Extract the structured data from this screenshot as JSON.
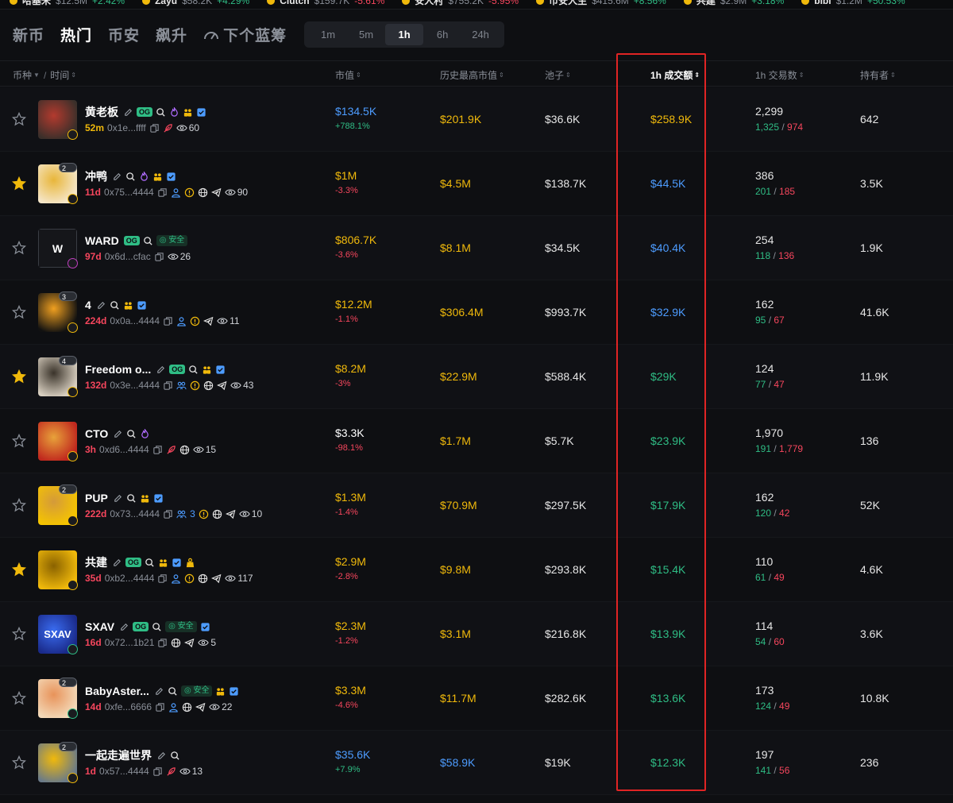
{
  "ticker": [
    {
      "name": "哈基米",
      "value": "$12.5M",
      "change": "+2.42%",
      "dir": "up"
    },
    {
      "name": "Zayu",
      "value": "$58.2K",
      "change": "+4.29%",
      "dir": "up"
    },
    {
      "name": "Clutch",
      "value": "$159.7K",
      "change": "-5.61%",
      "dir": "dn"
    },
    {
      "name": "安人村",
      "value": "$755.2K",
      "change": "-5.95%",
      "dir": "dn"
    },
    {
      "name": "币安人生",
      "value": "$415.6M",
      "change": "+8.56%",
      "dir": "up"
    },
    {
      "name": "共建",
      "value": "$2.9M",
      "change": "+3.18%",
      "dir": "up"
    },
    {
      "name": "bibi",
      "value": "$1.2M",
      "change": "+50.53%",
      "dir": "up"
    }
  ],
  "nav": {
    "tabs": [
      "新币",
      "热门",
      "币安",
      "飙升",
      "下个蓝筹"
    ],
    "active_tab": "热门",
    "timeframes": [
      "1m",
      "5m",
      "1h",
      "6h",
      "24h"
    ],
    "active_timeframe": "1h"
  },
  "columns": {
    "token": "币种",
    "time": "时间",
    "mcap": "市值",
    "ath": "历史最高市值",
    "pool": "池子",
    "volume": "1h 成交额",
    "txns": "1h 交易数",
    "holders": "持有者"
  },
  "sort_glyph": "⇕",
  "rows": [
    {
      "starred": false,
      "name": "黄老板",
      "badge": "",
      "chain": "bnb",
      "avatar_colors": [
        "#3a2f2a",
        "#b33a2e"
      ],
      "avatar_glyph": "",
      "icons": [
        "edit-icon",
        "og",
        "search-icon",
        "fire-icon",
        "group-icon",
        "verified-icon"
      ],
      "age": "52m",
      "fresh": true,
      "addr": "0x1e...ffff",
      "sub_icons": [
        "copy-icon",
        "feather-icon"
      ],
      "views": "60",
      "mcap": "$134.5K",
      "mcap_color": "blue",
      "mcap_chg": "+788.1%",
      "mcap_dir": "up",
      "ath": "$201.9K",
      "pool": "$36.6K",
      "vol": "$258.9K",
      "vol_color": "yellow",
      "txns": "2,299",
      "buys": "1,325",
      "sells": "974",
      "holders": "642"
    },
    {
      "starred": true,
      "name": "冲鸭",
      "badge": "2",
      "chain": "bnb",
      "avatar_colors": [
        "#f5e6c8",
        "#e8b63a"
      ],
      "avatar_glyph": "",
      "icons": [
        "edit-icon",
        "search-icon",
        "fire-icon",
        "group-icon",
        "verified-icon"
      ],
      "age": "11d",
      "fresh": false,
      "addr": "0x75...4444",
      "sub_icons": [
        "copy-icon",
        "user-icon",
        "warning-icon",
        "globe-icon",
        "telegram-icon"
      ],
      "views": "90",
      "mcap": "$1M",
      "mcap_color": "yellow",
      "mcap_chg": "-3.3%",
      "mcap_dir": "dn",
      "ath": "$4.5M",
      "pool": "$138.7K",
      "vol": "$44.5K",
      "vol_color": "blue",
      "txns": "386",
      "buys": "201",
      "sells": "185",
      "holders": "3.5K"
    },
    {
      "starred": false,
      "name": "WARD",
      "badge": "",
      "chain": "other",
      "avatar_colors": [
        "#15161a",
        "#15161a"
      ],
      "avatar_glyph": "W",
      "icons": [
        "og",
        "search-icon",
        "safe"
      ],
      "safe_label": "安全",
      "age": "97d",
      "fresh": false,
      "addr": "0x6d...cfac",
      "sub_icons": [
        "copy-icon"
      ],
      "views": "26",
      "mcap": "$806.7K",
      "mcap_color": "yellow",
      "mcap_chg": "-3.6%",
      "mcap_dir": "dn",
      "ath": "$8.1M",
      "pool": "$34.5K",
      "vol": "$40.4K",
      "vol_color": "blue",
      "txns": "254",
      "buys": "118",
      "sells": "136",
      "holders": "1.9K"
    },
    {
      "starred": false,
      "name": "4",
      "badge": "3",
      "chain": "bnb",
      "avatar_colors": [
        "#111111",
        "#f0a020"
      ],
      "avatar_glyph": "",
      "icons": [
        "edit-icon",
        "search-icon",
        "group-icon",
        "verified-icon"
      ],
      "age": "224d",
      "fresh": false,
      "addr": "0x0a...4444",
      "sub_icons": [
        "copy-icon",
        "user-icon",
        "warning-icon",
        "telegram-icon"
      ],
      "views": "11",
      "mcap": "$12.2M",
      "mcap_color": "yellow",
      "mcap_chg": "-1.1%",
      "mcap_dir": "dn",
      "ath": "$306.4M",
      "pool": "$993.7K",
      "vol": "$32.9K",
      "vol_color": "blue",
      "txns": "162",
      "buys": "95",
      "sells": "67",
      "holders": "41.6K"
    },
    {
      "starred": true,
      "name": "Freedom o...",
      "badge": "4",
      "chain": "bnb",
      "avatar_colors": [
        "#d8cfc0",
        "#3a332a"
      ],
      "avatar_glyph": "",
      "icons": [
        "edit-icon",
        "og",
        "search-icon",
        "group-icon",
        "verified-icon"
      ],
      "age": "132d",
      "fresh": false,
      "addr": "0x3e...4444",
      "sub_icons": [
        "copy-icon",
        "users-icon",
        "warning-icon",
        "globe-icon",
        "telegram-icon"
      ],
      "views": "43",
      "mcap": "$8.2M",
      "mcap_color": "yellow",
      "mcap_chg": "-3%",
      "mcap_dir": "dn",
      "ath": "$22.9M",
      "pool": "$588.4K",
      "vol": "$29K",
      "vol_color": "green",
      "txns": "124",
      "buys": "77",
      "sells": "47",
      "holders": "11.9K"
    },
    {
      "starred": false,
      "name": "CTO",
      "badge": "",
      "chain": "bnb",
      "avatar_colors": [
        "#c0281e",
        "#e8a23a"
      ],
      "avatar_glyph": "",
      "icons": [
        "edit-icon",
        "search-icon",
        "fire-icon"
      ],
      "age": "3h",
      "fresh": false,
      "addr": "0xd6...4444",
      "sub_icons": [
        "copy-icon",
        "feather-icon",
        "globe-icon"
      ],
      "views": "15",
      "mcap": "$3.3K",
      "mcap_color": "white",
      "mcap_chg": "-98.1%",
      "mcap_dir": "dn",
      "ath": "$1.7M",
      "pool": "$5.7K",
      "vol": "$23.9K",
      "vol_color": "green",
      "txns": "1,970",
      "buys": "191",
      "sells": "1,779",
      "holders": "136"
    },
    {
      "starred": false,
      "name": "PUP",
      "badge": "2",
      "chain": "bnb",
      "avatar_colors": [
        "#f5c400",
        "#d49a3a"
      ],
      "avatar_glyph": "",
      "icons": [
        "edit-icon",
        "search-icon",
        "group-icon",
        "verified-icon"
      ],
      "age": "222d",
      "fresh": false,
      "addr": "0x73...4444",
      "sub_icons": [
        "copy-icon",
        "users-icon",
        "warning-icon",
        "globe-icon",
        "telegram-icon"
      ],
      "users_count": "3",
      "views": "10",
      "mcap": "$1.3M",
      "mcap_color": "yellow",
      "mcap_chg": "-1.4%",
      "mcap_dir": "dn",
      "ath": "$70.9M",
      "pool": "$297.5K",
      "vol": "$17.9K",
      "vol_color": "green",
      "txns": "162",
      "buys": "120",
      "sells": "42",
      "holders": "52K"
    },
    {
      "starred": true,
      "name": "共建",
      "badge": "",
      "chain": "bnb",
      "avatar_colors": [
        "#f0b90b",
        "#8a6200"
      ],
      "avatar_glyph": "",
      "icons": [
        "edit-icon",
        "og",
        "search-icon",
        "group-icon",
        "verified-icon",
        "bag-icon"
      ],
      "age": "35d",
      "fresh": false,
      "addr": "0xb2...4444",
      "sub_icons": [
        "copy-icon",
        "user-icon",
        "warning-icon",
        "globe-icon",
        "telegram-icon"
      ],
      "views": "117",
      "mcap": "$2.9M",
      "mcap_color": "yellow",
      "mcap_chg": "-2.8%",
      "mcap_dir": "dn",
      "ath": "$9.8M",
      "pool": "$293.8K",
      "vol": "$15.4K",
      "vol_color": "green",
      "txns": "110",
      "buys": "61",
      "sells": "49",
      "holders": "4.6K"
    },
    {
      "starred": false,
      "name": "SXAV",
      "badge": "",
      "chain": "other",
      "avatar_colors": [
        "#1a2a8a",
        "#3a6cf0"
      ],
      "avatar_glyph": "SXAV",
      "icons": [
        "edit-icon",
        "og",
        "search-icon",
        "safe",
        "verified-icon"
      ],
      "safe_label": "安全",
      "age": "16d",
      "fresh": false,
      "addr": "0x72...1b21",
      "sub_icons": [
        "copy-icon",
        "globe-icon",
        "telegram-icon"
      ],
      "views": "5",
      "mcap": "$2.3M",
      "mcap_color": "yellow",
      "mcap_chg": "-1.2%",
      "mcap_dir": "dn",
      "ath": "$3.1M",
      "pool": "$216.8K",
      "vol": "$13.9K",
      "vol_color": "green",
      "txns": "114",
      "buys": "54",
      "sells": "60",
      "holders": "3.6K"
    },
    {
      "starred": false,
      "name": "BabyAster...",
      "badge": "2",
      "chain": "other",
      "avatar_colors": [
        "#f3d9b8",
        "#e8935a"
      ],
      "avatar_glyph": "",
      "icons": [
        "edit-icon",
        "search-icon",
        "safe",
        "group-icon",
        "verified-icon"
      ],
      "safe_label": "安全",
      "age": "14d",
      "fresh": false,
      "addr": "0xfe...6666",
      "sub_icons": [
        "copy-icon",
        "user-icon",
        "globe-icon",
        "telegram-icon"
      ],
      "views": "22",
      "mcap": "$3.3M",
      "mcap_color": "yellow",
      "mcap_chg": "-4.6%",
      "mcap_dir": "dn",
      "ath": "$11.7M",
      "pool": "$282.6K",
      "vol": "$13.6K",
      "vol_color": "green",
      "txns": "173",
      "buys": "124",
      "sells": "49",
      "holders": "10.8K"
    },
    {
      "starred": false,
      "name": "一起走遍世界",
      "badge": "2",
      "chain": "bnb",
      "avatar_colors": [
        "#6a7a88",
        "#f0b90b"
      ],
      "avatar_glyph": "",
      "icons": [
        "edit-icon",
        "search-icon"
      ],
      "age": "1d",
      "fresh": false,
      "addr": "0x57...4444",
      "sub_icons": [
        "copy-icon",
        "feather-icon"
      ],
      "views": "13",
      "mcap": "$35.6K",
      "mcap_color": "blue",
      "mcap_chg": "+7.9%",
      "mcap_dir": "up",
      "ath": "$58.9K",
      "ath_color": "blue",
      "pool": "$19K",
      "vol": "$12.3K",
      "vol_color": "green",
      "txns": "197",
      "buys": "141",
      "sells": "56",
      "holders": "236"
    }
  ]
}
